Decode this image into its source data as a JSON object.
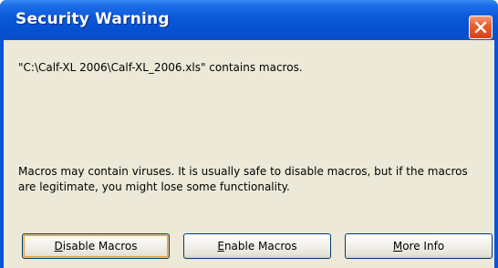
{
  "dialog": {
    "title": "Security Warning",
    "close_icon": "close-x-icon",
    "message_path": "\"C:\\Calf-XL 2006\\Calf-XL_2006.xls\" contains macros.",
    "message_warning": "Macros may contain viruses. It is usually safe to disable macros, but if the macros are legitimate, you might lose some functionality."
  },
  "buttons": {
    "disable": {
      "accel": "D",
      "rest": "isable Macros"
    },
    "enable": {
      "accel": "E",
      "rest": "nable Macros"
    },
    "more": {
      "accel": "M",
      "rest": "ore Info"
    }
  },
  "colors": {
    "titlebar": "#0a58d8",
    "close_button": "#d6421b",
    "client_background": "#ece9d8",
    "default_button_focus": "#e4a03c"
  }
}
